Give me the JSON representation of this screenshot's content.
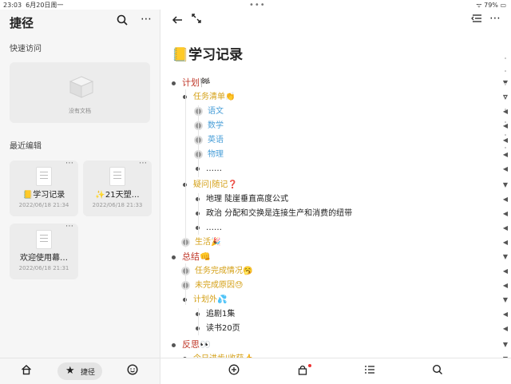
{
  "status": {
    "time": "23:03",
    "date": "6月20日周一",
    "battery": "79%"
  },
  "sidebar": {
    "title": "捷径",
    "quick_access": "快速访问",
    "empty_text": "没有文档",
    "recent": "最近编辑",
    "docs": [
      {
        "name": "📒学习记录",
        "date": "2022/06/18 21:34"
      },
      {
        "name": "✨21天塑…",
        "date": "2022/06/18 21:33"
      },
      {
        "name": "欢迎使用幕…",
        "date": "2022/06/18 21:31"
      }
    ],
    "tab_shortcut": "捷径"
  },
  "doc": {
    "title": "📒学习记录",
    "colors": {
      "plan": "#c0392b",
      "task": "#d4a017",
      "subject": "#4a9fd8",
      "text": "#222"
    },
    "items": [
      {
        "text": "计划🏁"
      },
      {
        "text": "任务清单👏"
      },
      {
        "text": "语文"
      },
      {
        "text": "数学"
      },
      {
        "text": "英语"
      },
      {
        "text": "物理"
      },
      {
        "text": "……"
      },
      {
        "text": "疑问|随记❓"
      },
      {
        "text": "地理 陡崖垂直高度公式"
      },
      {
        "text": "政治 分配和交换是连接生产和消费的纽带"
      },
      {
        "text": "……"
      },
      {
        "text": "生活🎉"
      },
      {
        "text": "总结👊"
      },
      {
        "text": "任务完成情况🥱"
      },
      {
        "text": "未完成原因😓"
      },
      {
        "text": "计划外💦"
      },
      {
        "text": "追剧1集"
      },
      {
        "text": "读书20页"
      },
      {
        "text": "反思👀"
      },
      {
        "text": "今日进步|收获👍"
      }
    ]
  }
}
